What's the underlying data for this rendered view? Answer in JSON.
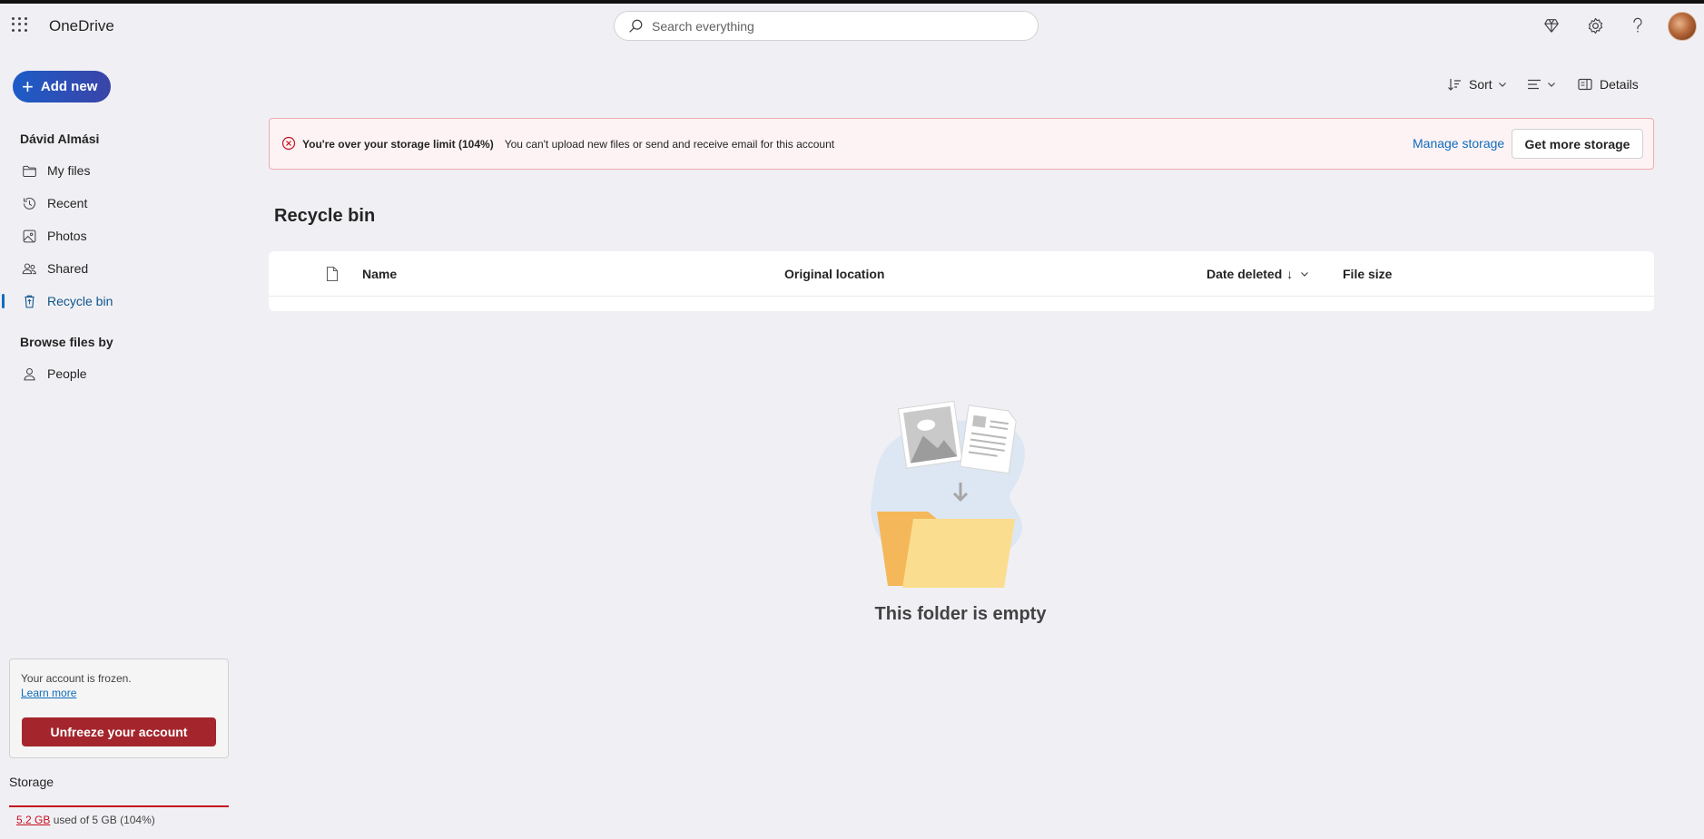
{
  "app": {
    "title": "OneDrive"
  },
  "search": {
    "placeholder": "Search everything"
  },
  "header": {
    "icons": [
      "premium-diamond-icon",
      "settings-gear-icon",
      "help-icon"
    ]
  },
  "nav": {
    "add_new_label": "Add new",
    "user_name": "Dávid Almási",
    "items": [
      {
        "label": "My files",
        "icon": "folder-icon"
      },
      {
        "label": "Recent",
        "icon": "history-icon"
      },
      {
        "label": "Photos",
        "icon": "photo-icon"
      },
      {
        "label": "Shared",
        "icon": "people-icon"
      },
      {
        "label": "Recycle bin",
        "icon": "recycle-bin-icon",
        "active": true
      }
    ],
    "browse_section": "Browse files by",
    "browse_items": [
      {
        "label": "People",
        "icon": "person-icon"
      }
    ]
  },
  "frozen": {
    "text": "Your account is frozen.",
    "learn_more": "Learn more",
    "button": "Unfreeze your account"
  },
  "storage": {
    "title": "Storage",
    "used": "5.2 GB",
    "rest": " used of 5 GB (104%)",
    "usage_percent": 104,
    "bar_color": "#c50f1f"
  },
  "toolbar": {
    "sort_label": "Sort",
    "details_label": "Details"
  },
  "banner": {
    "title": "You're over your storage limit (104%)",
    "message": "You can't upload new files or send and receive email for this account",
    "manage_link": "Manage storage",
    "get_more_button": "Get more storage"
  },
  "page": {
    "title": "Recycle bin"
  },
  "table": {
    "columns": {
      "name": "Name",
      "original_location": "Original location",
      "date_deleted": "Date deleted",
      "file_size": "File size"
    },
    "sort_arrow": "↓"
  },
  "empty": {
    "text": "This folder is empty"
  },
  "colors": {
    "accent": "#0f6cbd",
    "danger": "#a4262c",
    "banner_bg": "#fdf3f4",
    "background": "#f0f0f4"
  }
}
